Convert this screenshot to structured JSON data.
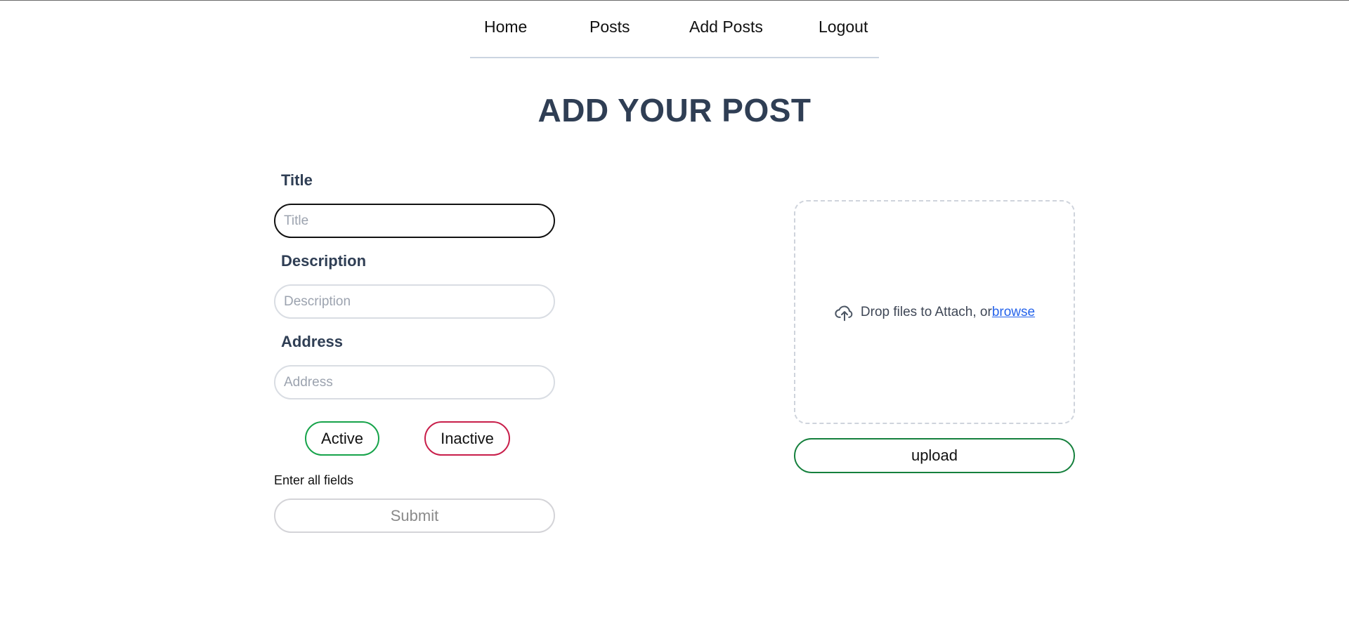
{
  "nav": {
    "items": [
      {
        "label": "Home"
      },
      {
        "label": "Posts"
      },
      {
        "label": "Add Posts"
      },
      {
        "label": "Logout"
      }
    ]
  },
  "page": {
    "title": "ADD YOUR POST"
  },
  "form": {
    "title": {
      "label": "Title",
      "placeholder": "Title",
      "value": ""
    },
    "description": {
      "label": "Description",
      "placeholder": "Description",
      "value": ""
    },
    "address": {
      "label": "Address",
      "placeholder": "Address",
      "value": ""
    },
    "status": {
      "active_label": "Active",
      "inactive_label": "Inactive"
    },
    "hint": "Enter all fields",
    "submit_label": "Submit"
  },
  "upload": {
    "drop_text": "Drop files to Attach, or",
    "browse_text": "browse",
    "button_label": "upload",
    "icon": "cloud-upload-icon"
  },
  "colors": {
    "title": "#2f3e54",
    "active_border": "#16a34a",
    "inactive_border": "#c81e4a",
    "upload_border": "#15803d",
    "link": "#2563eb"
  }
}
